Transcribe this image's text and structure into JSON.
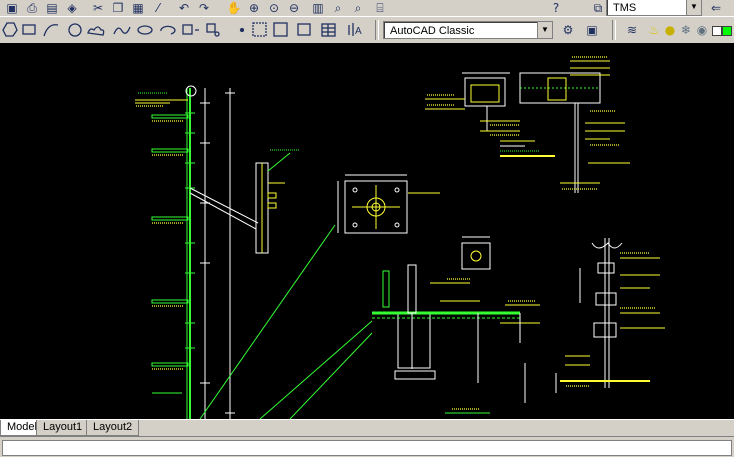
{
  "toolbar_top": {
    "layer_value": "TMS"
  },
  "toolbar_draw": {
    "workspace_value": "AutoCAD Classic",
    "icons": [
      "polygon-icon",
      "rectangle-icon",
      "arc-icon",
      "circle-icon",
      "revcloud-icon",
      "spline-icon",
      "ellipse-icon",
      "ellipse-arc-icon",
      "insert-block-icon",
      "make-block-icon",
      "point-icon",
      "hatch-icon",
      "gradient-icon",
      "region-icon",
      "table-icon"
    ]
  },
  "layout_tabs": {
    "model": "Model",
    "layout1": "Layout1",
    "layout2": "Layout2"
  },
  "colors": {
    "cad_green": "#33ff33",
    "cad_yellow": "#ffff33",
    "cad_white": "#ffffff",
    "cad_cyan": "#33ffff",
    "background": "#000000"
  }
}
